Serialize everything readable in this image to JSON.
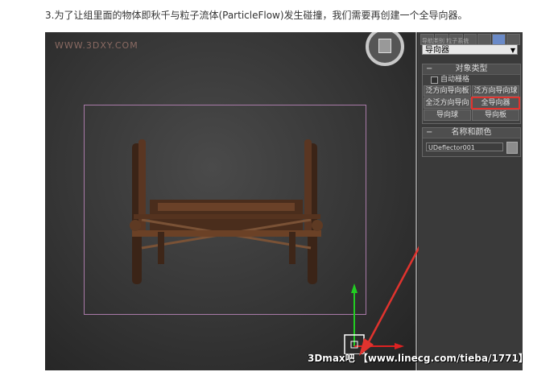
{
  "caption": "3.为了让组里面的物体即秋千与粒子流体(ParticleFlow)发生碰撞，我们需要再创建一个全导向器。",
  "viewport": {
    "watermark": "WWW.3DXY.COM",
    "credit": "3Dmax吧 【www.linecg.com/tieba/1771】"
  },
  "panel": {
    "toolbar_label": "导航类别 粒子系统",
    "category_dropdown": "导向器",
    "object_type": {
      "title": "对象类型",
      "auto_grid": "自动栅格",
      "buttons": [
        "泛方向导向板",
        "泛方向导向球",
        "全泛方向导向",
        "全导向器",
        "导向球",
        "导向板"
      ]
    },
    "name_color": {
      "title": "名称和颜色",
      "name_value": "UDeflector001"
    }
  },
  "colors": {
    "highlight": "#e0332e",
    "bbox": "#a97aa8",
    "gizmo_y": "#22cc22",
    "gizmo_x": "#dd2222"
  }
}
